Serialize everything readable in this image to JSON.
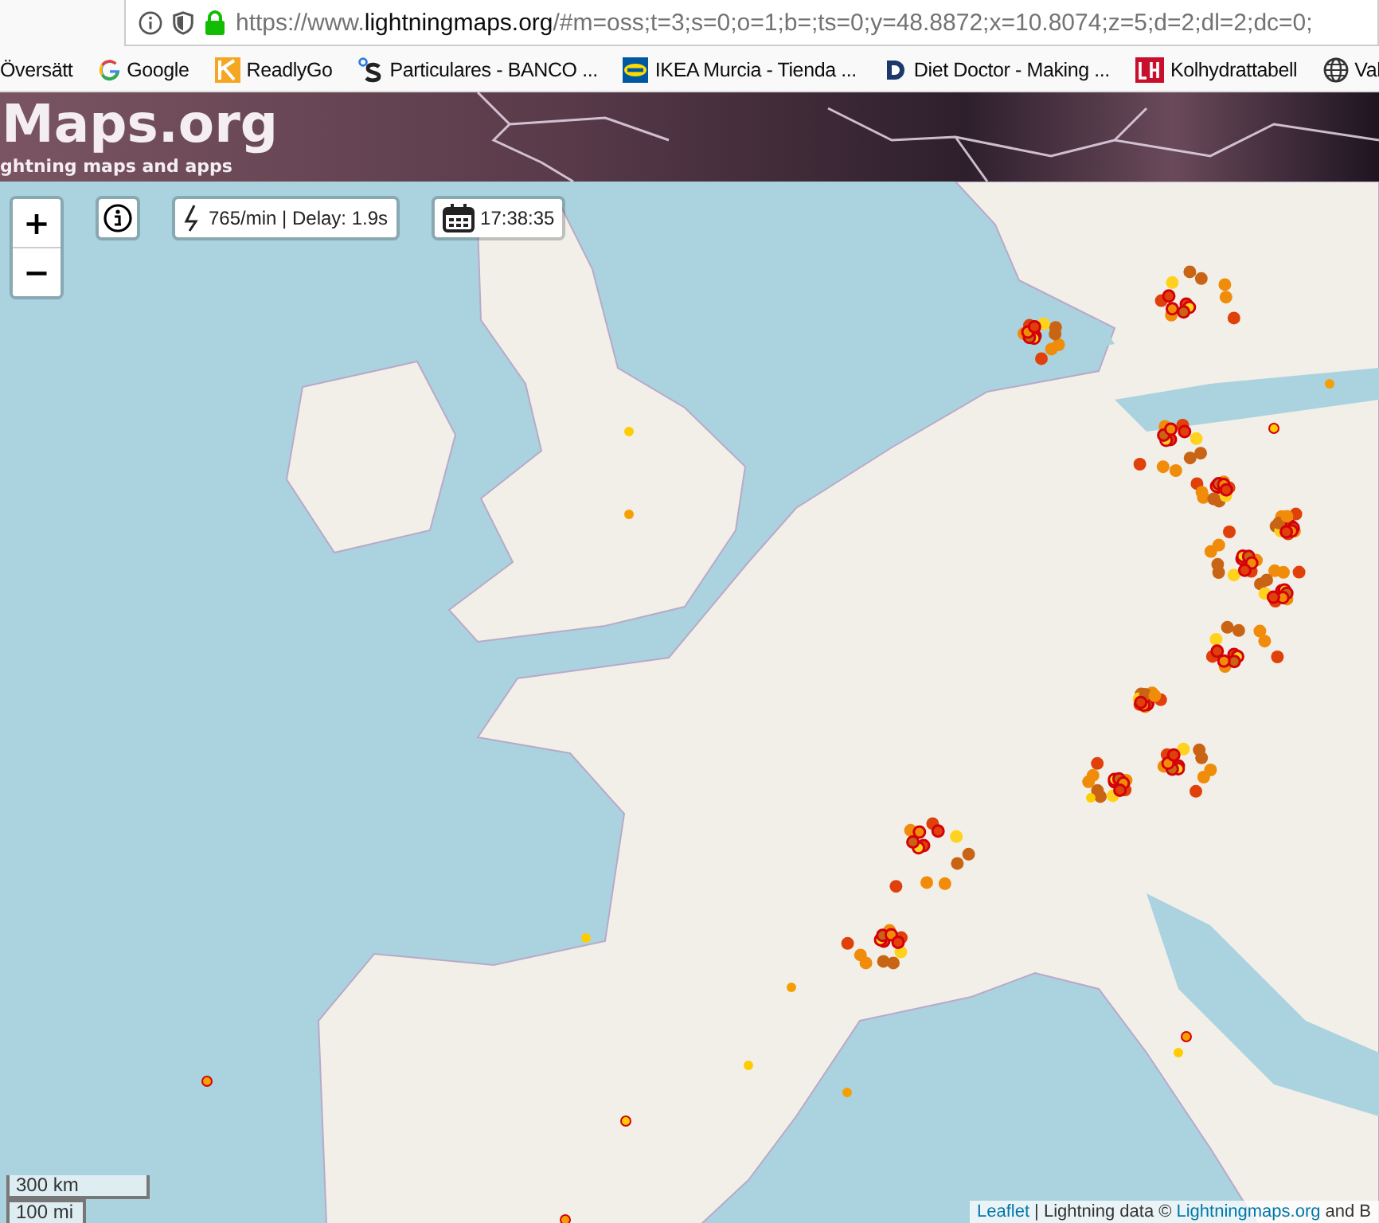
{
  "address_bar": {
    "url_start": "https://www.",
    "url_domain": "lightningmaps.org",
    "url_rest": "/#m=oss;t=3;s=0;o=1;b=;ts=0;y=48.8872;x=10.8074;z=5;d=2;dl=2;dc=0;"
  },
  "bookmarks": [
    {
      "label": "Översätt",
      "kind": "plain"
    },
    {
      "label": "Google",
      "kind": "google"
    },
    {
      "label": "ReadlyGo",
      "kind": "readlygo"
    },
    {
      "label": "Particulares - BANCO ...",
      "kind": "ds"
    },
    {
      "label": "IKEA Murcia - Tienda ...",
      "kind": "ikea"
    },
    {
      "label": "Diet Doctor - Making ...",
      "kind": "dietdoctor"
    },
    {
      "label": "Kolhydrattabell",
      "kind": "lchf"
    },
    {
      "label": "Val",
      "kind": "globe"
    }
  ],
  "site_header": {
    "title": "Maps.org",
    "subtitle": "ghtning maps and apps"
  },
  "map_controls": {
    "zoom_in": "+",
    "zoom_out": "−",
    "stats": "765/min | Delay: 1.9s",
    "time": "17:38:35"
  },
  "scale": [
    "300 km",
    "100 mi"
  ],
  "attribution": [
    {
      "text": "Leaflet",
      "link": true
    },
    {
      "text": "| Lightning data ©",
      "link": false
    },
    {
      "text": "Lightningmaps.org",
      "link": true
    },
    {
      "text": "and B",
      "link": false
    }
  ]
}
